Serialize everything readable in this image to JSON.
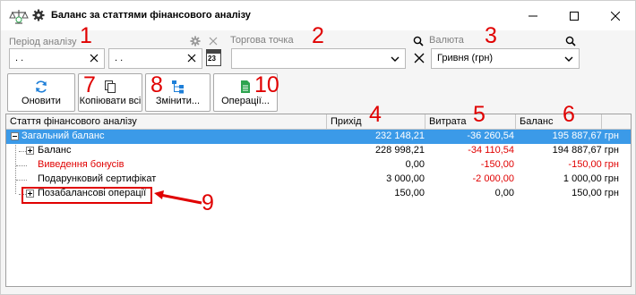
{
  "window": {
    "title": "Баланс за статтями фінансового аналізу"
  },
  "filters": {
    "period_label": "Період аналізу",
    "date_from": ". .",
    "date_to": ". .",
    "calendar_day": "23",
    "outlet_label": "Торгова точка",
    "outlet_value": "",
    "currency_label": "Валюта",
    "currency_value": "Гривня (грн)"
  },
  "toolbar": {
    "refresh": "Оновити",
    "copy_all": "Копіювати всі",
    "change": "Змінити...",
    "operations": "Операції..."
  },
  "grid": {
    "columns": [
      "Стаття фінансового аналізу",
      "Прихід",
      "Витрата",
      "Баланс"
    ],
    "rows": [
      {
        "name": "Загальний баланс",
        "income": "232 148,21",
        "expense": "-36 260,54",
        "balance": "195 887,67 грн"
      },
      {
        "name": "Баланс",
        "income": "228 998,21",
        "expense": "-34 110,54",
        "balance": "194 887,67 грн"
      },
      {
        "name": "Виведення бонусів",
        "income": "0,00",
        "expense": "-150,00",
        "balance": "-150,00 грн"
      },
      {
        "name": "Подарунковий сертифікат",
        "income": "3 000,00",
        "expense": "-2 000,00",
        "balance": "1 000,00 грн"
      },
      {
        "name": "Позабалансові операції",
        "income": "150,00",
        "expense": "0,00",
        "balance": "150,00 грн"
      }
    ]
  },
  "annotations": [
    "1",
    "2",
    "3",
    "4",
    "5",
    "6",
    "7",
    "8",
    "9",
    "10"
  ],
  "colors": {
    "selection": "#3b9ae8",
    "negative": "#e00000",
    "annotation": "#e00000",
    "add_icon": "#2ea44f"
  }
}
